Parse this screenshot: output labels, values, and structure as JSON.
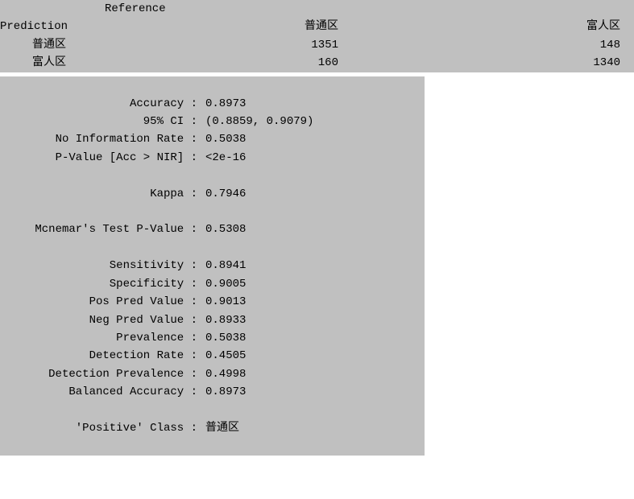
{
  "confusion_matrix": {
    "reference_header": "Reference",
    "prediction_header": "Prediction",
    "col_headers": [
      "普通区",
      "富人区"
    ],
    "rows": [
      {
        "label": "普通区",
        "values": [
          "1351",
          "148"
        ]
      },
      {
        "label": "富人区",
        "values": [
          "160",
          "1340"
        ]
      }
    ]
  },
  "stats": {
    "accuracy": {
      "label": "Accuracy :",
      "value": "0.8973"
    },
    "ci": {
      "label": "95% CI :",
      "value": "(0.8859, 0.9079)"
    },
    "nir": {
      "label": "No Information Rate :",
      "value": "0.5038"
    },
    "pvalue_acc_nir": {
      "label": "P-Value [Acc > NIR] :",
      "value": "<2e-16"
    },
    "kappa": {
      "label": "Kappa :",
      "value": "0.7946"
    },
    "mcnemar": {
      "label": "Mcnemar's Test P-Value :",
      "value": "0.5308"
    },
    "sensitivity": {
      "label": "Sensitivity :",
      "value": "0.8941"
    },
    "specificity": {
      "label": "Specificity :",
      "value": "0.9005"
    },
    "ppv": {
      "label": "Pos Pred Value :",
      "value": "0.9013"
    },
    "npv": {
      "label": "Neg Pred Value :",
      "value": "0.8933"
    },
    "prevalence": {
      "label": "Prevalence :",
      "value": "0.5038"
    },
    "detection_rate": {
      "label": "Detection Rate :",
      "value": "0.4505"
    },
    "detection_prevalence": {
      "label": "Detection Prevalence :",
      "value": "0.4998"
    },
    "balanced_accuracy": {
      "label": "Balanced Accuracy :",
      "value": "0.8973"
    },
    "positive_class": {
      "label": "'Positive' Class :",
      "value": "普通区"
    }
  }
}
